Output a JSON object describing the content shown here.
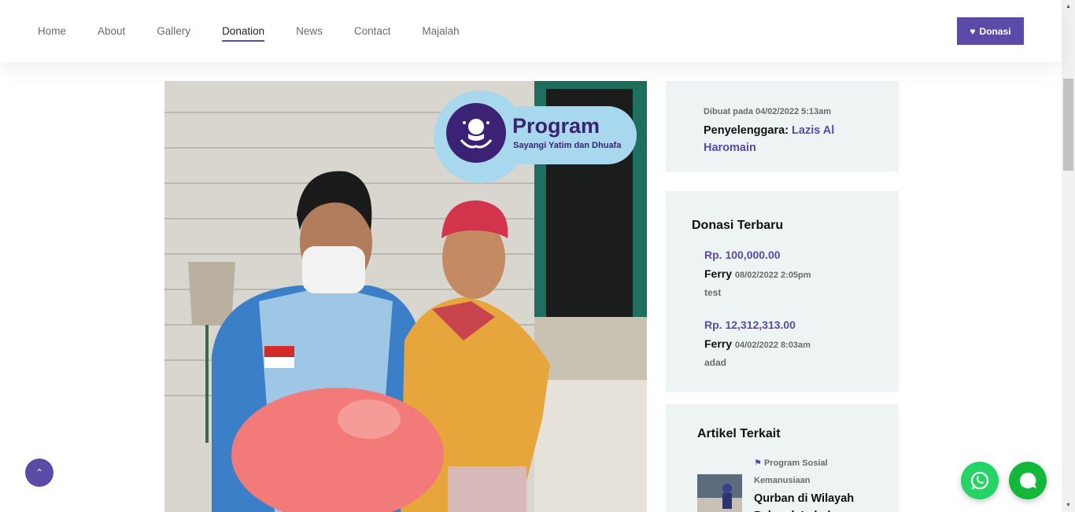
{
  "nav": {
    "items": [
      {
        "label": "Home",
        "active": false
      },
      {
        "label": "About",
        "active": false
      },
      {
        "label": "Gallery",
        "active": false
      },
      {
        "label": "Donation",
        "active": true
      },
      {
        "label": "News",
        "active": false
      },
      {
        "label": "Contact",
        "active": false
      },
      {
        "label": "Majalah",
        "active": false
      }
    ],
    "donate_button": {
      "label": "Donasi",
      "icon": "heart-icon"
    }
  },
  "program_badge": {
    "title": "Program",
    "subtitle": "Sayangi Yatim dan Dhuafa"
  },
  "info_card": {
    "created_label": "Dibuat pada 04/02/2022 5:13am",
    "organizer_label": "Penyelenggara:",
    "organizer_name": "Lazis Al Haromain"
  },
  "recent_donations": {
    "title": "Donasi Terbaru",
    "items": [
      {
        "amount": "Rp. 100,000.00",
        "name": "Ferry",
        "time": "08/02/2022 2:05pm",
        "message": "test"
      },
      {
        "amount": "Rp. 12,312,313.00",
        "name": "Ferry",
        "time": "04/02/2022 8:03am",
        "message": "adad"
      }
    ]
  },
  "related_articles": {
    "title": "Artikel Terkait",
    "items": [
      {
        "category": "Program Sosial Kemanusiaan",
        "title": "Qurban di Wilayah Pelosok Lebak"
      }
    ]
  },
  "colors": {
    "accent": "#5b4aa6",
    "card_bg": "#eef3f3",
    "badge_bg": "#a8d8ee",
    "badge_text": "#3b2275",
    "whatsapp": "#25d366"
  }
}
